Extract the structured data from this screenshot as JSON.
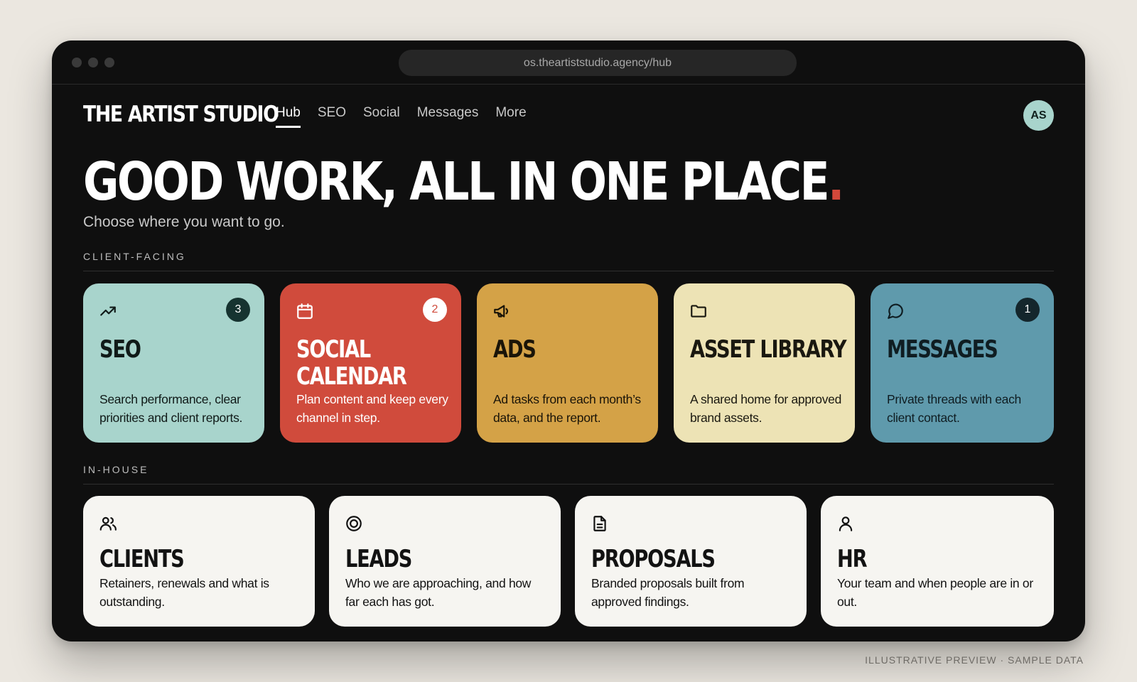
{
  "browser": {
    "url": "os.theartiststudio.agency/hub"
  },
  "nav": {
    "brand": "THE ARTIST STUDIO",
    "items": [
      {
        "label": "Hub",
        "active": true
      },
      {
        "label": "SEO",
        "active": false
      },
      {
        "label": "Social",
        "active": false
      },
      {
        "label": "Messages",
        "active": false
      },
      {
        "label": "More",
        "active": false
      }
    ],
    "avatar_initials": "AS"
  },
  "hero": {
    "title": "GOOD WORK, ALL IN ONE PLACE",
    "title_accent": ".",
    "subtitle": "Choose where you want to go."
  },
  "sections": {
    "client_facing": {
      "label": "CLIENT-FACING",
      "cards": [
        {
          "title": "SEO",
          "description": "Search performance, clear priorities and client reports.",
          "badge": "3",
          "icon": "trending-up-icon",
          "bg": "#a8d4cc"
        },
        {
          "title": "SOCIAL CALENDAR",
          "description": "Plan content and keep every channel in step.",
          "badge": "2",
          "icon": "calendar-icon",
          "bg": "#d04b3c"
        },
        {
          "title": "ADS",
          "description": "Ad tasks from each month’s data, and the report.",
          "badge": "",
          "icon": "megaphone-icon",
          "bg": "#d4a247"
        },
        {
          "title": "ASSET LIBRARY",
          "description": "A shared home for approved brand assets.",
          "badge": "",
          "icon": "folder-icon",
          "bg": "#ede3b5"
        },
        {
          "title": "MESSAGES",
          "description": "Private threads with each client contact.",
          "badge": "1",
          "icon": "chat-bubble-icon",
          "bg": "#5f9aac"
        }
      ]
    },
    "in_house": {
      "label": "IN-HOUSE",
      "cards": [
        {
          "title": "CLIENTS",
          "description": "Retainers, renewals and what is outstanding.",
          "icon": "users-icon"
        },
        {
          "title": "LEADS",
          "description": "Who we are approaching, and how far each has got.",
          "icon": "target-icon"
        },
        {
          "title": "PROPOSALS",
          "description": "Branded proposals built from approved findings.",
          "icon": "document-icon"
        },
        {
          "title": "HR",
          "description": "Your team and when people are in or out.",
          "icon": "user-icon"
        }
      ]
    }
  },
  "footer_note": "ILLUSTRATIVE PREVIEW · SAMPLE DATA"
}
